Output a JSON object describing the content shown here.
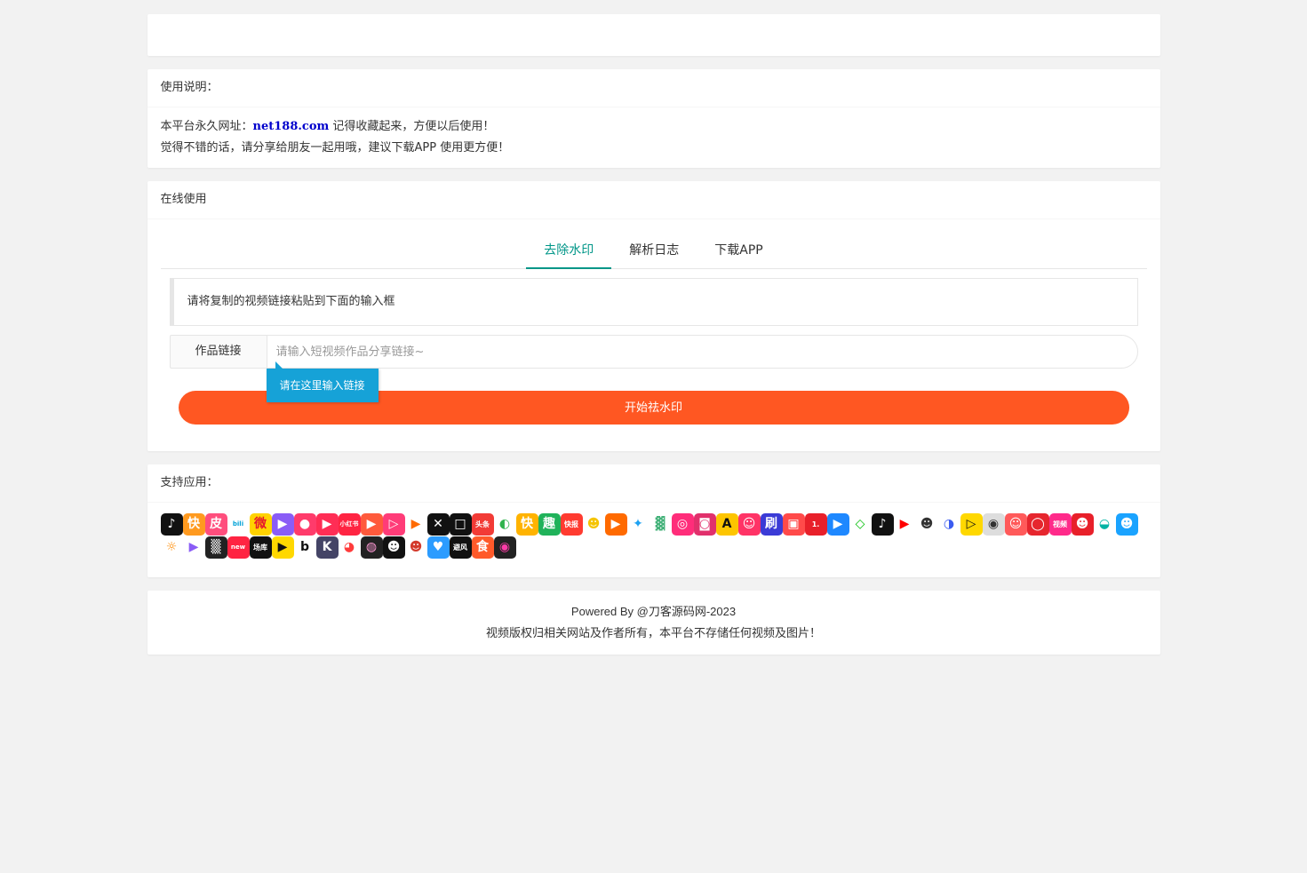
{
  "notice": {
    "title": "使用说明：",
    "line1_prefix": "本平台永久网址：",
    "line1_url": "net188.com",
    "line1_suffix": " 记得收藏起来，方便以后使用！",
    "line2": "觉得不错的话，请分享给朋友一起用哦，建议下载APP 使用更方便！"
  },
  "online": {
    "title": "在线使用",
    "tabs": [
      {
        "label": "去除水印",
        "active": true
      },
      {
        "label": "解析日志",
        "active": false
      },
      {
        "label": "下载APP",
        "active": false
      }
    ],
    "hint": "请将复制的视频链接粘贴到下面的输入框",
    "input_label": "作品链接",
    "input_placeholder": "请输入短视频作品分享链接~",
    "tooltip": "请在这里输入链接",
    "submit_label": "开始祛水印",
    "accent_color": "#009688",
    "button_color": "#ff5722",
    "tooltip_color": "#16a2d7"
  },
  "apps": {
    "title": "支持应用：",
    "icons": [
      {
        "name": "douyin-icon",
        "color": "#111111",
        "glyph": "♪"
      },
      {
        "name": "kuaishou-icon",
        "color": "#ff9a1f",
        "glyph": "快"
      },
      {
        "name": "pipixia-icon",
        "color": "#ff4e7d",
        "glyph": "皮"
      },
      {
        "name": "bilibili-icon",
        "color": "#ffffff",
        "glyph": "bili",
        "text": "#00a1d6"
      },
      {
        "name": "weibo-icon",
        "color": "#ffd300",
        "glyph": "微",
        "text": "#e6162d"
      },
      {
        "name": "weishi-icon",
        "color": "#8a5cf6",
        "glyph": "▶"
      },
      {
        "name": "meipai-icon",
        "color": "#ff3b6b",
        "glyph": "●"
      },
      {
        "name": "quanmin-icon",
        "color": "#ff2d55",
        "glyph": "▶"
      },
      {
        "name": "xiaohongshu-icon",
        "color": "#ff2442",
        "glyph": "小红书"
      },
      {
        "name": "zuiyou-icon",
        "color": "#ff5a3c",
        "glyph": "▶"
      },
      {
        "name": "lvzhou-icon",
        "color": "#ff3c78",
        "glyph": "▷"
      },
      {
        "name": "haokan-icon",
        "color": "#ffffff",
        "glyph": "▶",
        "text": "#ff6a00"
      },
      {
        "name": "capcut-icon",
        "color": "#111111",
        "glyph": "✕"
      },
      {
        "name": "huoshan-icon",
        "color": "#111111",
        "glyph": "□"
      },
      {
        "name": "toutiao-icon",
        "color": "#f23b36",
        "glyph": "头条"
      },
      {
        "name": "ppx-icon",
        "color": "#ffffff",
        "glyph": "◐",
        "text": "#2eb34c"
      },
      {
        "name": "kuai-icon",
        "color": "#ffb300",
        "glyph": "快"
      },
      {
        "name": "qutoutiao-icon",
        "color": "#20b25a",
        "glyph": "趣"
      },
      {
        "name": "kuaibao-icon",
        "color": "#ff3b30",
        "glyph": "快报"
      },
      {
        "name": "qq-bird-icon",
        "color": "#ffffff",
        "glyph": "☻",
        "text": "#f5c400"
      },
      {
        "name": "haokan2-icon",
        "color": "#ff6a00",
        "glyph": "▶"
      },
      {
        "name": "twitter-icon",
        "color": "#ffffff",
        "glyph": "✦",
        "text": "#1da1f2"
      },
      {
        "name": "lvzhou2-icon",
        "color": "#ffffff",
        "glyph": "▓",
        "text": "#44b27a"
      },
      {
        "name": "momo-icon",
        "color": "#ff2d7a",
        "glyph": "◎"
      },
      {
        "name": "instagram-icon",
        "color": "#e1306c",
        "glyph": "◙"
      },
      {
        "name": "acfun-icon",
        "color": "#fdc500",
        "glyph": "A",
        "text": "#111111"
      },
      {
        "name": "manhua-icon",
        "color": "#ff3366",
        "glyph": "☺"
      },
      {
        "name": "shua-icon",
        "color": "#3b3bd6",
        "glyph": "刷"
      },
      {
        "name": "tv-icon",
        "color": "#ff4a4a",
        "glyph": "▣"
      },
      {
        "name": "yidian-icon",
        "color": "#e8202a",
        "glyph": "1."
      },
      {
        "name": "youku-icon",
        "color": "#1e88ff",
        "glyph": "▶"
      },
      {
        "name": "iqiyi-icon",
        "color": "#ffffff",
        "glyph": "◇",
        "text": "#00be06"
      },
      {
        "name": "tiktok-icon",
        "color": "#111111",
        "glyph": "♪"
      },
      {
        "name": "youtube-icon",
        "color": "#ffffff",
        "glyph": "▶",
        "text": "#ff0000"
      },
      {
        "name": "panda-icon",
        "color": "#ffffff",
        "glyph": "☻",
        "text": "#333333"
      },
      {
        "name": "qq-icon",
        "color": "#ffffff",
        "glyph": "◑",
        "text": "#3b5cf0"
      },
      {
        "name": "huya-icon",
        "color": "#ffd800",
        "glyph": "▷",
        "text": "#111111"
      },
      {
        "name": "camera-icon",
        "color": "#dddddd",
        "glyph": "◉",
        "text": "#333333"
      },
      {
        "name": "face-icon",
        "color": "#ff5a5a",
        "glyph": "☺"
      },
      {
        "name": "netease-icon",
        "color": "#e6262e",
        "glyph": "◯"
      },
      {
        "name": "video-icon",
        "color": "#ff2a8a",
        "glyph": "视频"
      },
      {
        "name": "lizhi-icon",
        "color": "#e8202a",
        "glyph": "☻"
      },
      {
        "name": "bowl-icon",
        "color": "#ffffff",
        "glyph": "◒",
        "text": "#00b3a4"
      },
      {
        "name": "penguin-icon",
        "color": "#1aa3ff",
        "glyph": "☻"
      },
      {
        "name": "uc-icon",
        "color": "#ffffff",
        "glyph": "☼",
        "text": "#ff8a00"
      },
      {
        "name": "weishi2-icon",
        "color": "#ffffff",
        "glyph": "▶",
        "text": "#8a5cf6"
      },
      {
        "name": "pattern-icon",
        "color": "#222222",
        "glyph": "▒"
      },
      {
        "name": "new-icon",
        "color": "#ff2442",
        "glyph": "new"
      },
      {
        "name": "tanku-icon",
        "color": "#111111",
        "glyph": "场库"
      },
      {
        "name": "play-yellow-icon",
        "color": "#ffd800",
        "glyph": "▶",
        "text": "#111111"
      },
      {
        "name": "b-icon",
        "color": "#ffffff",
        "glyph": "b",
        "text": "#111111"
      },
      {
        "name": "k-icon",
        "color": "#444466",
        "glyph": "K"
      },
      {
        "name": "pin-icon",
        "color": "#ffffff",
        "glyph": "◕",
        "text": "#ff3b3b"
      },
      {
        "name": "cake-icon",
        "color": "#222222",
        "glyph": "◍",
        "text": "#ff9ad5"
      },
      {
        "name": "monster-icon",
        "color": "#111111",
        "glyph": "☻"
      },
      {
        "name": "monkey-icon",
        "color": "#ffffff",
        "glyph": "☻",
        "text": "#d33a2c"
      },
      {
        "name": "heart-icon",
        "color": "#2c9cff",
        "glyph": "♥"
      },
      {
        "name": "bifeng-icon",
        "color": "#111111",
        "glyph": "避风"
      },
      {
        "name": "shi-icon",
        "color": "#ff5a2a",
        "glyph": "食"
      },
      {
        "name": "circle-icon",
        "color": "#222222",
        "glyph": "◉",
        "text": "#ff3ca8"
      }
    ]
  },
  "footer": {
    "line1": "Powered By @刀客源码网-2023",
    "line2": "视频版权归相关网站及作者所有，本平台不存储任何视频及图片！"
  }
}
